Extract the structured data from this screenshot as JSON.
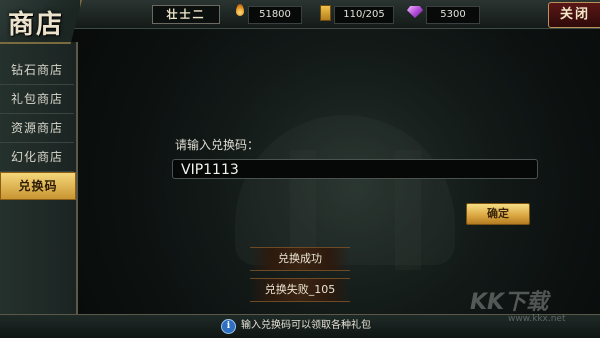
{
  "header": {
    "shop_title": "商店",
    "rank_label": "壮士二",
    "resources": [
      {
        "icon": "flame-icon",
        "value": "51800"
      },
      {
        "icon": "scroll-icon",
        "value": "110/205"
      },
      {
        "icon": "gem-icon",
        "value": "5300"
      }
    ],
    "close_label": "关闭"
  },
  "sidebar": {
    "items": [
      {
        "label": "钻石商店",
        "active": false
      },
      {
        "label": "礼包商店",
        "active": false
      },
      {
        "label": "资源商店",
        "active": false
      },
      {
        "label": "幻化商店",
        "active": false
      },
      {
        "label": "兑换码",
        "active": true
      }
    ]
  },
  "main": {
    "prompt_label": "请输入兑换码：",
    "code_value": "VIP1113",
    "confirm_label": "确定",
    "result_buttons": [
      "兑换成功",
      "兑换失败_105"
    ]
  },
  "footer": {
    "info_icon_glyph": "i",
    "hint_text": "输入兑换码可以领取各种礼包"
  },
  "watermark": {
    "main": "KK下载",
    "url": "www.kkx.net"
  },
  "colors": {
    "accent_gold": "#d9a540",
    "close_red": "#5a1716",
    "info_blue": "#2f6fc0"
  }
}
